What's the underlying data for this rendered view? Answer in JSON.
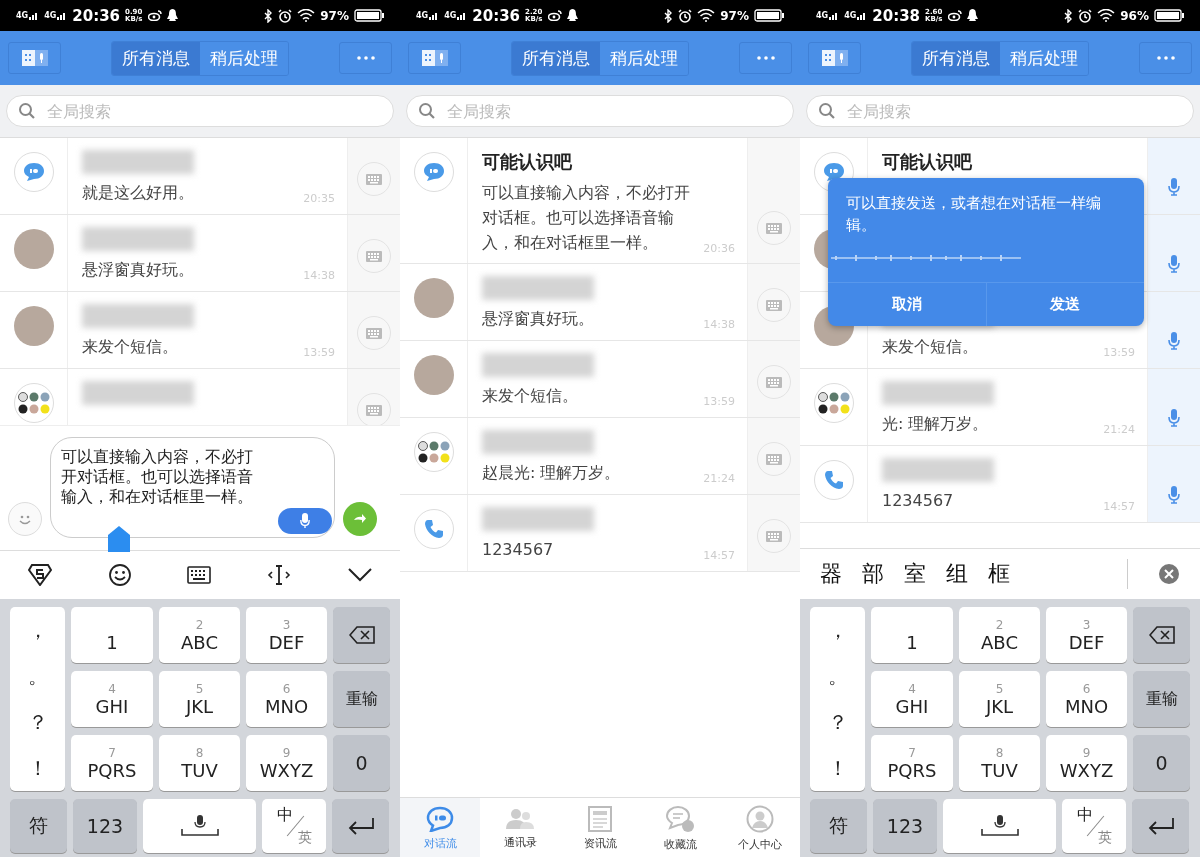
{
  "panels": [
    {
      "status_bar": {
        "network": [
          "4G",
          "4G"
        ],
        "time": "20:36",
        "speed": "0.90",
        "speed_unit": "KB/s",
        "battery": "97%"
      },
      "header": {
        "tabs": [
          {
            "label": "所有消息",
            "selected": true
          },
          {
            "label": "稍后处理",
            "selected": false
          }
        ]
      },
      "search": {
        "placeholder": "全局搜索"
      },
      "conversations": [
        {
          "avatar": {
            "kind": "app"
          },
          "name_blurred": true,
          "preview": "就是这么好用。",
          "time": "20:35",
          "action": {
            "kind": "keyboard"
          }
        },
        {
          "avatar": {
            "kind": "photo"
          },
          "name_blurred": true,
          "preview": "悬浮窗真好玩。",
          "time": "14:38",
          "action": {
            "kind": "keyboard"
          }
        },
        {
          "avatar": {
            "kind": "photo"
          },
          "name_blurred": true,
          "preview": "来发个短信。",
          "time": "13:59",
          "action": {
            "kind": "keyboard"
          }
        },
        {
          "avatar": {
            "kind": "group"
          },
          "name_blurred": true,
          "action": {
            "kind": "keyboard"
          }
        }
      ],
      "composer": {
        "value": "可以直接输入内容，不必打开对话框。也可以选择语音输入，和在对话框里一样。"
      },
      "keyboard": {
        "toolbar": true,
        "punctuation": [
          "，",
          "。",
          "？",
          "！"
        ],
        "one": "1",
        "keys": [
          {
            "label": "ABC",
            "digit": "2"
          },
          {
            "label": "DEF",
            "digit": "3"
          },
          {
            "label": "GHI",
            "digit": "4"
          },
          {
            "label": "JKL",
            "digit": "5"
          },
          {
            "label": "MNO",
            "digit": "6"
          },
          {
            "label": "PQRS",
            "digit": "7"
          },
          {
            "label": "TUV",
            "digit": "8"
          },
          {
            "label": "WXYZ",
            "digit": "9"
          }
        ],
        "reset": "重输",
        "zero": "0",
        "symbols": "符",
        "numbers": "123",
        "lang_main": "中",
        "lang_alt": "英"
      }
    },
    {
      "status_bar": {
        "network": [
          "4G",
          "4G"
        ],
        "time": "20:36",
        "speed": "2.20",
        "speed_unit": "KB/s",
        "battery": "97%"
      },
      "header": {
        "tabs": [
          {
            "label": "所有消息",
            "selected": true
          },
          {
            "label": "稍后处理",
            "selected": false
          }
        ]
      },
      "search": {
        "placeholder": "全局搜索"
      },
      "conversations": [
        {
          "avatar": {
            "kind": "app"
          },
          "name": "可能认识吧",
          "preview": "可以直接输入内容，不必打开对话框。也可以选择语音输入，和在对话框里一样。",
          "time": "20:36",
          "action": {
            "kind": "keyboard"
          }
        },
        {
          "avatar": {
            "kind": "photo"
          },
          "name_blurred": true,
          "preview": "悬浮窗真好玩。",
          "time": "14:38",
          "action": {
            "kind": "keyboard"
          }
        },
        {
          "avatar": {
            "kind": "photo"
          },
          "name_blurred": true,
          "preview": "来发个短信。",
          "time": "13:59",
          "action": {
            "kind": "keyboard"
          }
        },
        {
          "avatar": {
            "kind": "group"
          },
          "name_blurred": true,
          "preview": "赵晨光: 理解万岁。",
          "time": "21:24",
          "action": {
            "kind": "keyboard"
          }
        },
        {
          "avatar": {
            "kind": "phone"
          },
          "name_blurred": true,
          "preview": "1234567",
          "time": "14:57",
          "action": {
            "kind": "keyboard"
          }
        }
      ],
      "nav": [
        {
          "kind": "chat",
          "label": "对话流",
          "selected": true
        },
        {
          "kind": "contacts",
          "label": "通讯录",
          "selected": false
        },
        {
          "kind": "news",
          "label": "资讯流",
          "selected": false
        },
        {
          "kind": "favorites",
          "label": "收藏流",
          "selected": false
        },
        {
          "kind": "person",
          "label": "个人中心",
          "selected": false
        }
      ]
    },
    {
      "status_bar": {
        "network": [
          "4G",
          "4G"
        ],
        "time": "20:38",
        "speed": "2.60",
        "speed_unit": "KB/s",
        "battery": "96%"
      },
      "header": {
        "tabs": [
          {
            "label": "所有消息",
            "selected": true
          },
          {
            "label": "稍后处理",
            "selected": false
          }
        ]
      },
      "search": {
        "placeholder": "全局搜索"
      },
      "conversations": [
        {
          "avatar": {
            "kind": "app"
          },
          "name": "可能认识吧",
          "action": {
            "kind": "mic"
          }
        },
        {
          "avatar": {
            "kind": "photo"
          },
          "action": {
            "kind": "mic"
          }
        },
        {
          "avatar": {
            "kind": "photo"
          },
          "name_blurred": true,
          "preview": "来发个短信。",
          "time": "13:59",
          "action": {
            "kind": "mic"
          }
        },
        {
          "avatar": {
            "kind": "group"
          },
          "name_blurred": true,
          "preview": "光: 理解万岁。",
          "time": "21:24",
          "action": {
            "kind": "mic"
          }
        },
        {
          "avatar": {
            "kind": "phone"
          },
          "name_blurred": true,
          "preview": "1234567",
          "time": "14:57",
          "action": {
            "kind": "mic"
          }
        }
      ],
      "voice_popup": {
        "text": "可以直接发送，或者想在对话框一样编辑。",
        "buttons": [
          "取消",
          "发送"
        ]
      },
      "keyboard": {
        "candidates": [
          "器",
          "部",
          "室",
          "组",
          "框"
        ],
        "punctuation": [
          "，",
          "。",
          "？",
          "！"
        ],
        "one": "1",
        "keys": [
          {
            "label": "ABC",
            "digit": "2"
          },
          {
            "label": "DEF",
            "digit": "3"
          },
          {
            "label": "GHI",
            "digit": "4"
          },
          {
            "label": "JKL",
            "digit": "5"
          },
          {
            "label": "MNO",
            "digit": "6"
          },
          {
            "label": "PQRS",
            "digit": "7"
          },
          {
            "label": "TUV",
            "digit": "8"
          },
          {
            "label": "WXYZ",
            "digit": "9"
          }
        ],
        "reset": "重输",
        "zero": "0",
        "symbols": "符",
        "numbers": "123",
        "lang_main": "中",
        "lang_alt": "英"
      }
    }
  ]
}
